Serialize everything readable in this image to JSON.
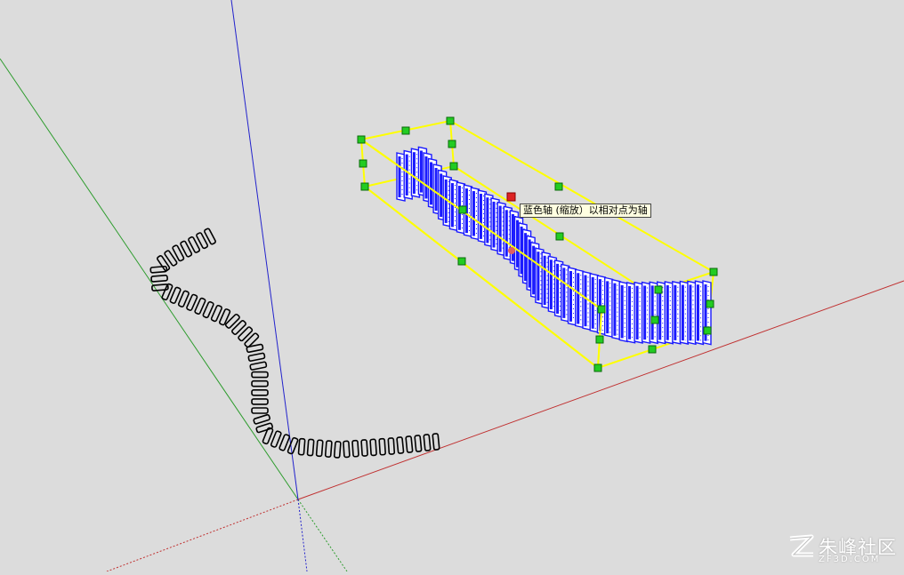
{
  "tooltip": {
    "text": "蓝色轴 (缩放）以相对点为轴"
  },
  "watermark": {
    "text": "朱峰社区",
    "sub": "ZF3D.COM",
    "logo_icon": "zf-logo-icon"
  },
  "colors": {
    "background": "#dcdcdc",
    "axis_red": "#c03030",
    "axis_green": "#2e9c2e",
    "axis_blue": "#2222cc",
    "bounding_box": "#ffff00",
    "grip": "#22cc22",
    "pivot": "#dd2222",
    "selected_geometry": "#1a1aff",
    "unselected_geometry": "#000000"
  }
}
